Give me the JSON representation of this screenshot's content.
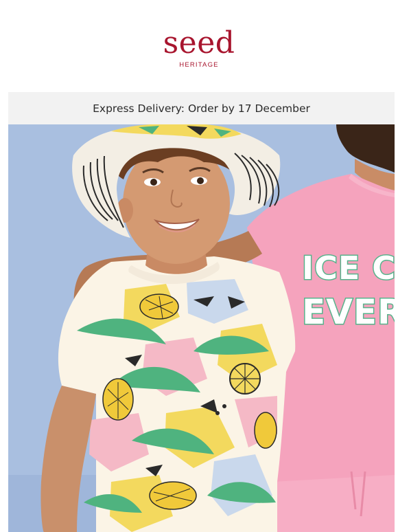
{
  "brand": {
    "name": "seed",
    "subname": "HERITAGE",
    "color": "#a8152e"
  },
  "banner": {
    "label": "Express Delivery:",
    "text": "Order by 17 December"
  },
  "hero": {
    "shirt_graphic_text": [
      "ICE CR",
      "EVER"
    ]
  }
}
